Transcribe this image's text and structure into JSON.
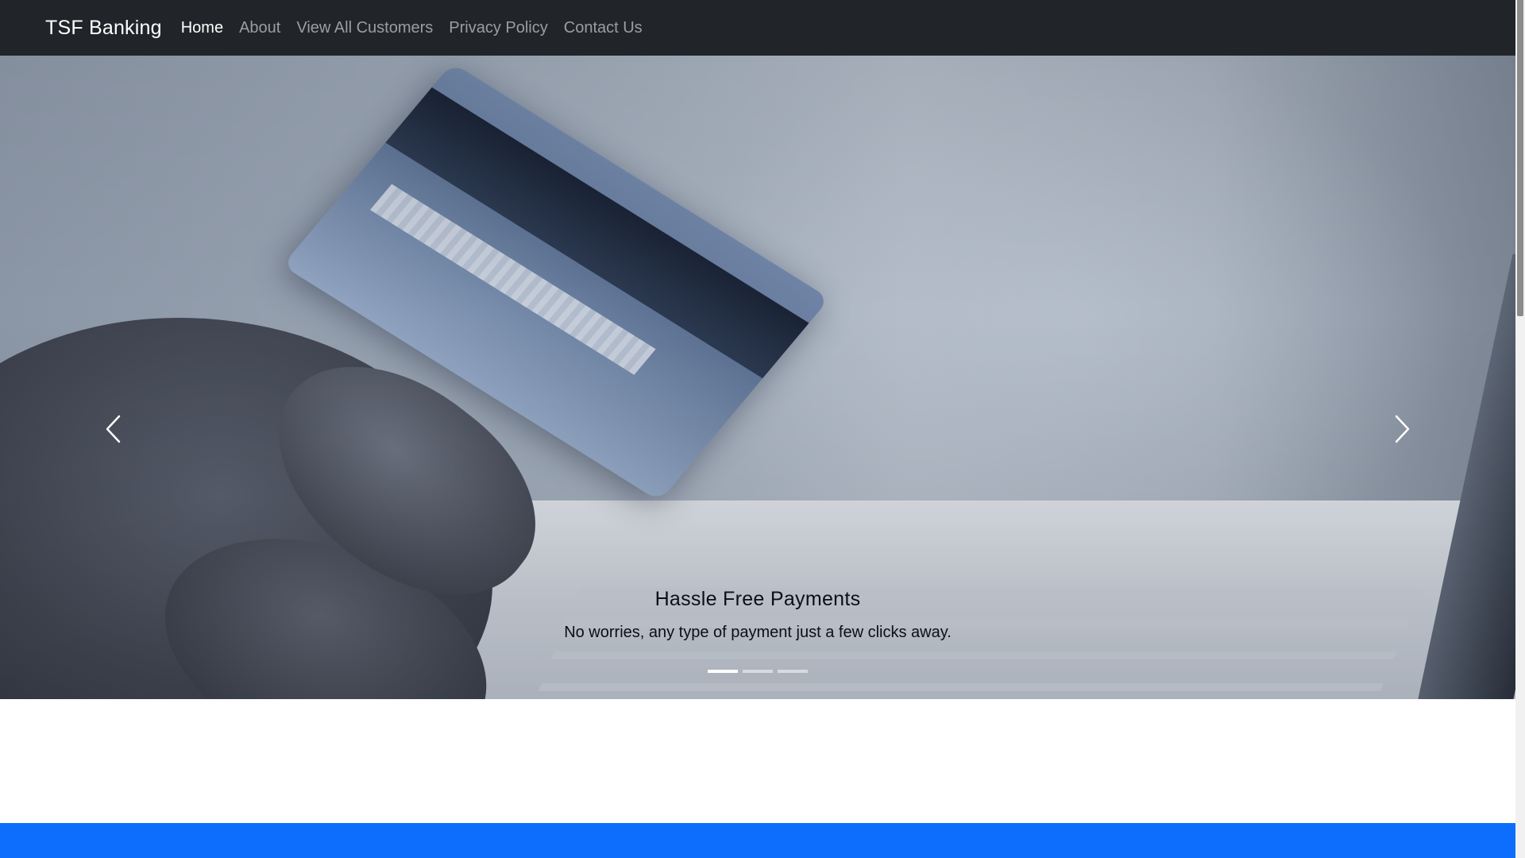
{
  "navbar": {
    "brand": "TSF Banking",
    "links": [
      {
        "label": "Home",
        "active": true
      },
      {
        "label": "About",
        "active": false
      },
      {
        "label": "View All Customers",
        "active": false
      },
      {
        "label": "Privacy Policy",
        "active": false
      },
      {
        "label": "Contact Us",
        "active": false
      }
    ]
  },
  "carousel": {
    "image_subject": "hand-holding-credit-card-over-laptop",
    "caption": {
      "title": "Hassle Free Payments",
      "text": "No worries, any type of payment just a few clicks away."
    },
    "indicators": [
      {
        "active": true
      },
      {
        "active": false
      },
      {
        "active": false
      }
    ],
    "prev_icon": "chevron-left-icon",
    "next_icon": "chevron-right-icon"
  },
  "colors": {
    "navbar_bg": "#212529",
    "accent_blue": "#0d6efd",
    "nav_active": "#ffffff",
    "nav_inactive": "rgba(255,255,255,0.55)"
  }
}
